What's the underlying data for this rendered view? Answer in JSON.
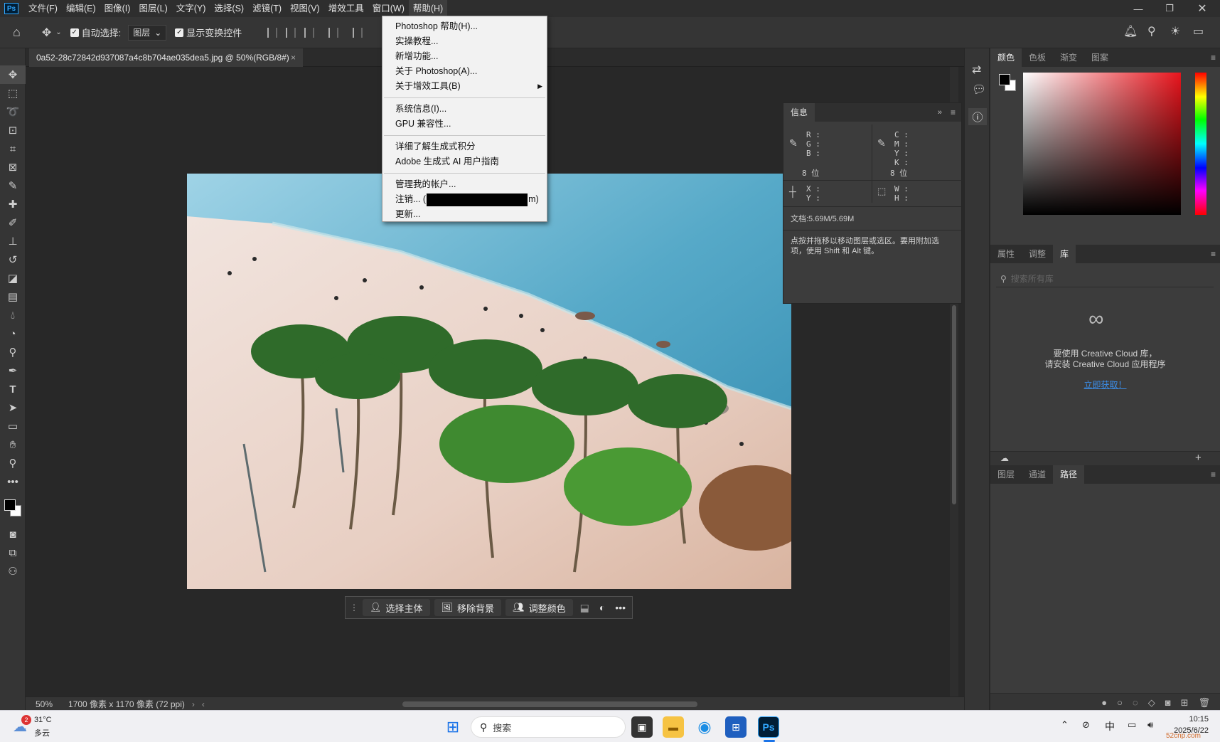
{
  "menubar": {
    "items": [
      "文件(F)",
      "编辑(E)",
      "图像(I)",
      "图层(L)",
      "文字(Y)",
      "选择(S)",
      "滤镜(T)",
      "视图(V)",
      "增效工具",
      "窗口(W)",
      "帮助(H)"
    ],
    "app_icon": "Ps"
  },
  "options": {
    "auto_select_label": "自动选择:",
    "auto_select_value": "图层",
    "show_transform_label": "显示变换控件"
  },
  "document": {
    "tab_title": "0a52-28c72842d937087a4c8b704ae035dea5.jpg @ 50%(RGB/8#)",
    "zoom": "50%",
    "size_info": "1700 像素 x 1170 像素 (72 ppi)"
  },
  "help_menu": {
    "group1": [
      "Photoshop 帮助(H)...",
      "实操教程...",
      "新增功能...",
      "关于 Photoshop(A)...",
      "关于增效工具(B)"
    ],
    "group2": [
      "系统信息(I)...",
      "GPU 兼容性..."
    ],
    "group3": [
      "详细了解生成式积分",
      "Adobe 生成式 AI 用户指南"
    ],
    "group4_manage": "管理我的帐户...",
    "signout_prefix": "注销... (",
    "signout_suffix": "m)",
    "update": "更新..."
  },
  "context_bar": {
    "select_subject": "选择主体",
    "remove_bg": "移除背景",
    "adjust_color": "调整颜色"
  },
  "info_panel": {
    "tab": "信息",
    "rgb": "R :\nG :\nB :",
    "cmyk": "C :\nM :\nY :\nK :",
    "bit_left": "8 位",
    "bit_right": "8 位",
    "xy": "X :\nY :",
    "wh": "W :\nH :",
    "doc": "文档:5.69M/5.69M",
    "hint": "点按并拖移以移动图层或选区。要用附加选项，使用 Shift 和 Alt 键。"
  },
  "color_panel": {
    "tabs": [
      "颜色",
      "色板",
      "渐变",
      "图案"
    ]
  },
  "library_panel": {
    "tabs": [
      "属性",
      "调整",
      "库"
    ],
    "search_placeholder": "搜索所有库",
    "message_line1": "要使用 Creative Cloud 库，",
    "message_line2": "请安装 Creative Cloud 应用程序",
    "link": "立即获取！"
  },
  "layers_panel": {
    "tabs": [
      "图层",
      "通道",
      "路径"
    ]
  },
  "taskbar": {
    "weather_temp": "31°C",
    "weather_desc": "多云",
    "weather_badge": "2",
    "search": "搜索",
    "ime": "中",
    "time": "10:15",
    "date": "2025/6/22",
    "watermark": "52cnp.com"
  },
  "colors": {
    "accent": "#31a8ff",
    "link": "#2f7fe0"
  }
}
